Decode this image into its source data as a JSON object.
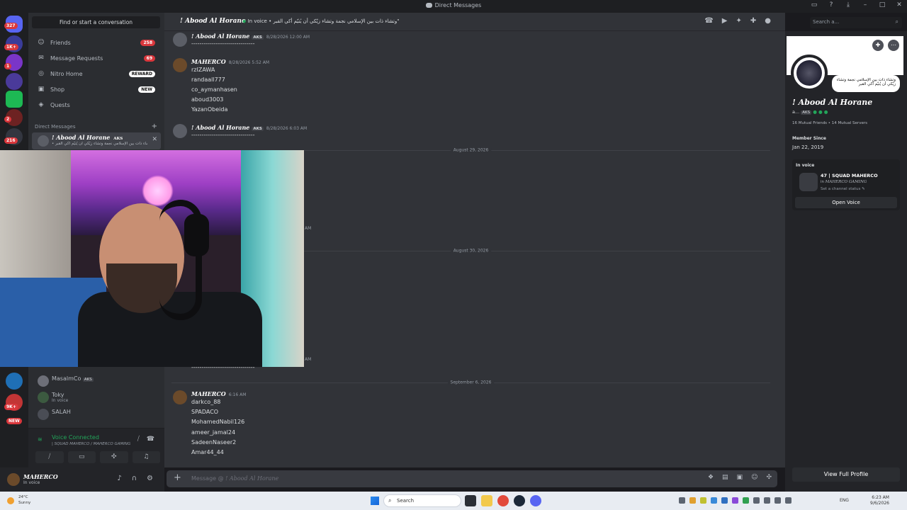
{
  "window": {
    "title": "Direct Messages"
  },
  "rail": {
    "servers": [
      {
        "color": "#5865f2",
        "badge": "327"
      },
      {
        "color": "#3a3c9a",
        "badge": "1K+"
      },
      {
        "color": "#7a35c8",
        "badge": "1"
      },
      {
        "color": "#4a3a9a",
        "badge": ""
      },
      {
        "color": "#1db954",
        "badge": ""
      },
      {
        "color": "#6d2222",
        "badge": "2"
      },
      {
        "color": "#333640",
        "badge": "216"
      }
    ],
    "bottom_servers": [
      {
        "color": "#1f6fb5",
        "badge": ""
      },
      {
        "color": "#c23535",
        "badge": "9K+"
      },
      {
        "color": "#da373c",
        "badge": "NEW"
      }
    ]
  },
  "sidebar": {
    "find_label": "Find or start a conversation",
    "nav": [
      {
        "label": "Friends",
        "icon": "friends-icon",
        "glyph": "☺",
        "badge": "258",
        "badge_style": "red"
      },
      {
        "label": "Message Requests",
        "icon": "envelope-icon",
        "glyph": "✉",
        "badge": "69",
        "badge_style": "red"
      },
      {
        "label": "Nitro Home",
        "icon": "nitro-icon",
        "glyph": "◎",
        "badge": "REWARD",
        "badge_style": "white"
      },
      {
        "label": "Shop",
        "icon": "shop-icon",
        "glyph": "▣",
        "badge": "NEW",
        "badge_style": "white"
      },
      {
        "label": "Quests",
        "icon": "quests-icon",
        "glyph": "◈",
        "badge": "",
        "badge_style": ""
      }
    ],
    "dm_header": "Direct Messages",
    "active_dm": {
      "name": "! Abood Al Horane",
      "tag": "AKS",
      "status": "• وتشاء ذات بين الإسلامي نجمة وتشاء زيّكي أن يُنيّم أكي القبر"
    },
    "dms": [
      {
        "name": "MasalmCo",
        "tag": "AKS",
        "sub": ""
      },
      {
        "name": "Toky",
        "tag": "",
        "sub": "In voice"
      },
      {
        "name": "SALAH",
        "tag": "",
        "sub": ""
      }
    ]
  },
  "voice": {
    "connected_label": "Voice Connected",
    "channel": "| SQUAD MAHERCO / MAHERCO GAMING"
  },
  "user": {
    "name": "MAHERCO",
    "status": "In voice"
  },
  "header": {
    "name": "! Abood Al Horane",
    "status_prefix": "In voice",
    "status_text": "• وتشاء ذات بين الإسلامي نجمة وتشاء زيّكي أن يُنيّم أكي القبر\"",
    "search_placeholder": "Search a..."
  },
  "messages": {
    "m1": {
      "author": "! Abood Al Horane",
      "tag": "AKS",
      "time": "8/28/2026 12:00 AM",
      "line": "-------------------------------"
    },
    "m2": {
      "author": "MAHERCO",
      "time": "8/28/2026 5:52 AM",
      "lines": [
        "rzIZAWA",
        "randaall777",
        "co_aymanhasen",
        "aboud3003",
        "YazanObeida"
      ]
    },
    "m3": {
      "author": "! Abood Al Horane",
      "tag": "AKS",
      "time": "8/28/2026 6:03 AM",
      "line": "-------------------------------"
    },
    "d1": "August 29, 2026",
    "d2": "August 30, 2026",
    "am1": "AM",
    "am2": "AM",
    "dash_tail": "-------------------------------",
    "d3": "September 6, 2026",
    "m4": {
      "author": "MAHERCO",
      "time": "6:16 AM",
      "lines": [
        "darkco_88",
        "SPADACO",
        "MohamedNabil126",
        "ameer_jamal24",
        "SadeenNaseer2",
        "Amar44_44"
      ]
    }
  },
  "composer": {
    "placeholder_prefix": "Message @",
    "placeholder_name": "! Abood Al Horane"
  },
  "profile": {
    "bubble": "وتشاء ذات بين الإسلامي نجمة وتشاء زيّكي أن يُنيّم أكي القبر",
    "name": "! Abood Al Horane",
    "tag_prefix": "a...",
    "tag": "AKS",
    "mutual": "16 Mutual Friends • 14 Mutual Servers",
    "member_since_label": "Member Since",
    "member_since": "Jan 22, 2019",
    "in_voice_label": "In voice",
    "squad": "47 | SQUAD MAHERCO",
    "in_server_prefix": "in",
    "in_server": "MAHERCO GAMING",
    "set_status": "Set a channel status",
    "open_voice": "Open Voice",
    "view_full": "View Full Profile"
  },
  "taskbar": {
    "temp": "24°C",
    "weather": "Sunny",
    "search": "Search",
    "lang": "ENG",
    "time": "6:23 AM",
    "date": "9/6/2026"
  }
}
